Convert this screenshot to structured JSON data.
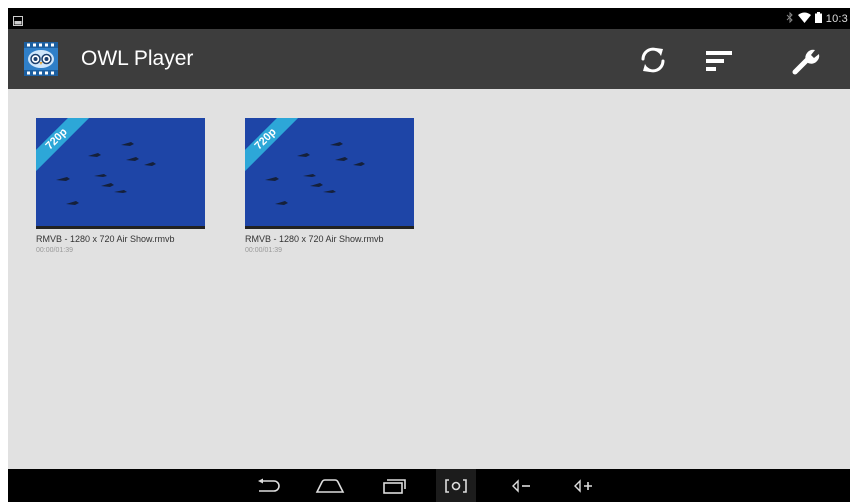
{
  "status_bar": {
    "time": "10:3",
    "icons": [
      "screenshot-notification-icon",
      "bluetooth-icon",
      "wifi-icon",
      "battery-icon"
    ]
  },
  "action_bar": {
    "app_title": "OWL Player",
    "app_icon": "owl-player-icon",
    "actions": [
      "refresh-icon",
      "sort-icon",
      "settings-wrench-icon"
    ]
  },
  "videos": [
    {
      "title": "RMVB - 1280 x 720 Air Show.rmvb",
      "duration": "00:00/01:39",
      "badge": "720p"
    },
    {
      "title": "RMVB - 1280 x 720 Air Show.rmvb",
      "duration": "00:00/01:39",
      "badge": "720p"
    }
  ],
  "nav_bar": {
    "buttons": [
      "back-icon",
      "home-icon",
      "recent-apps-icon",
      "screenshot-icon",
      "volume-down-icon",
      "volume-up-icon"
    ]
  },
  "colors": {
    "action_bar": "#3d3d3d",
    "background": "#e1e1e1",
    "badge": "#2da7d8",
    "thumbnail_sky": "#1e45a7"
  }
}
